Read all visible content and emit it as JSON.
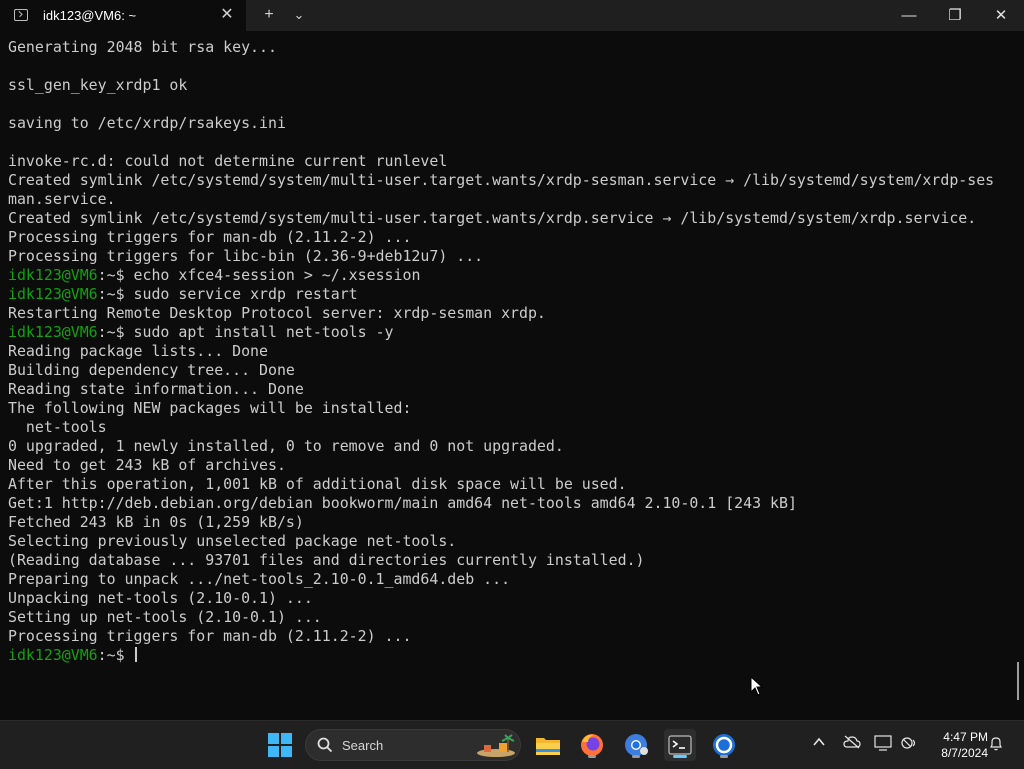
{
  "window": {
    "tab_title": "idk123@VM6: ~",
    "close_tab_glyph": "✕",
    "new_tab_glyph": "+",
    "dropdown_glyph": "⌄",
    "minimize_glyph": "—",
    "restore_glyph": "❐",
    "close_glyph": "✕"
  },
  "terminal": {
    "colors": {
      "background": "#0c0c0c",
      "text": "#cccccc",
      "prompt_user": "#13a10e"
    },
    "lines": [
      {
        "text": "Generating 2048 bit rsa key..."
      },
      {
        "text": ""
      },
      {
        "text": "ssl_gen_key_xrdp1 ok"
      },
      {
        "text": ""
      },
      {
        "text": "saving to /etc/xrdp/rsakeys.ini"
      },
      {
        "text": ""
      },
      {
        "text": "invoke-rc.d: could not determine current runlevel"
      },
      {
        "text": "Created symlink /etc/systemd/system/multi-user.target.wants/xrdp-sesman.service → /lib/systemd/system/xrdp-ses"
      },
      {
        "text": "man.service."
      },
      {
        "text": "Created symlink /etc/systemd/system/multi-user.target.wants/xrdp.service → /lib/systemd/system/xrdp.service."
      },
      {
        "text": "Processing triggers for man-db (2.11.2-2) ..."
      },
      {
        "text": "Processing triggers for libc-bin (2.36-9+deb12u7) ..."
      },
      {
        "prompt": "idk123@VM6",
        "path": ":~$",
        "text": " echo xfce4-session > ~/.xsession"
      },
      {
        "prompt": "idk123@VM6",
        "path": ":~$",
        "text": " sudo service xrdp restart"
      },
      {
        "text": "Restarting Remote Desktop Protocol server: xrdp-sesman xrdp."
      },
      {
        "prompt": "idk123@VM6",
        "path": ":~$",
        "text": " sudo apt install net-tools -y"
      },
      {
        "text": "Reading package lists... Done"
      },
      {
        "text": "Building dependency tree... Done"
      },
      {
        "text": "Reading state information... Done"
      },
      {
        "text": "The following NEW packages will be installed:"
      },
      {
        "text": "  net-tools"
      },
      {
        "text": "0 upgraded, 1 newly installed, 0 to remove and 0 not upgraded."
      },
      {
        "text": "Need to get 243 kB of archives."
      },
      {
        "text": "After this operation, 1,001 kB of additional disk space will be used."
      },
      {
        "text": "Get:1 http://deb.debian.org/debian bookworm/main amd64 net-tools amd64 2.10-0.1 [243 kB]"
      },
      {
        "text": "Fetched 243 kB in 0s (1,259 kB/s)"
      },
      {
        "text": "Selecting previously unselected package net-tools."
      },
      {
        "text": "(Reading database ... 93701 files and directories currently installed.)"
      },
      {
        "text": "Preparing to unpack .../net-tools_2.10-0.1_amd64.deb ..."
      },
      {
        "text": "Unpacking net-tools (2.10-0.1) ..."
      },
      {
        "text": "Setting up net-tools (2.10-0.1) ..."
      },
      {
        "text": "Processing triggers for man-db (2.11.2-2) ..."
      },
      {
        "prompt": "idk123@VM6",
        "path": ":~$",
        "text": " ",
        "cursor": true
      }
    ]
  },
  "taskbar": {
    "search_label": "Search",
    "pinned": [
      {
        "name": "start-button",
        "icon": "windows-logo-icon"
      },
      {
        "name": "file-explorer",
        "icon": "folder-icon"
      },
      {
        "name": "firefox",
        "icon": "firefox-icon"
      },
      {
        "name": "chrome",
        "icon": "chrome-icon"
      },
      {
        "name": "terminal",
        "icon": "terminal-icon",
        "active": true
      },
      {
        "name": "browser",
        "icon": "browser-ring-icon"
      }
    ],
    "tray_icons": [
      "chevron-up-icon",
      "cloud-offline-icon",
      "display-icon",
      "network-volume-icon",
      "bell-icon"
    ],
    "time": "4:47 PM",
    "date": "8/7/2024",
    "accent": "#60cdff"
  }
}
